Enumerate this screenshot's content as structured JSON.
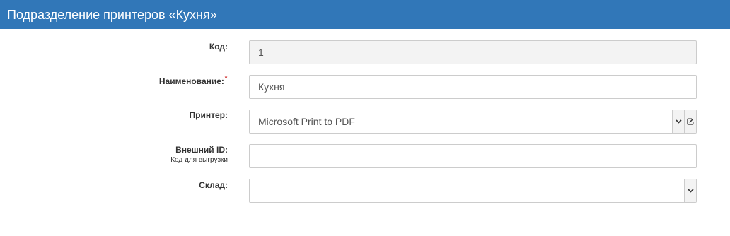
{
  "header": {
    "title": "Подразделение принтеров «Кухня»"
  },
  "form": {
    "code": {
      "label": "Код:",
      "value": "1"
    },
    "name": {
      "label": "Наименование:",
      "required_mark": "*",
      "value": "Кухня"
    },
    "printer": {
      "label": "Принтер:",
      "value": "Microsoft Print to PDF"
    },
    "external_id": {
      "label": "Внешний ID:",
      "sublabel": "Код для выгрузки",
      "value": ""
    },
    "warehouse": {
      "label": "Склад:",
      "value": ""
    }
  },
  "icons": {
    "printer_dropdown": "chevron-down-icon",
    "printer_edit": "edit-icon",
    "warehouse_dropdown": "chevron-down-icon"
  },
  "colors": {
    "header_bg": "#3177b8",
    "required": "#cc2222",
    "field_border": "#cccccc",
    "readonly_bg": "#f3f3f3"
  }
}
